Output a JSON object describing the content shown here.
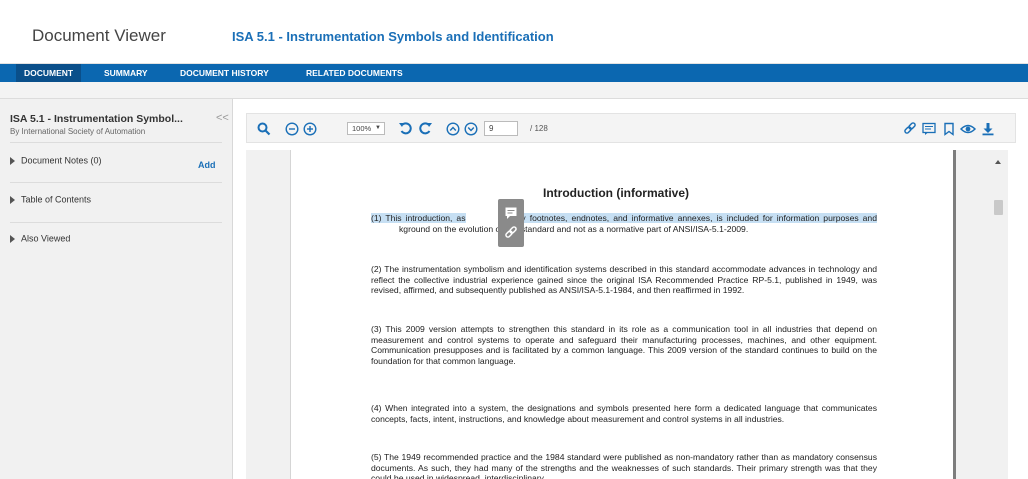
{
  "header": {
    "app_title": "Document Viewer",
    "doc_title": "ISA 5.1 - Instrumentation Symbols and Identification"
  },
  "nav": {
    "tabs": [
      {
        "label": "DOCUMENT",
        "active": true
      },
      {
        "label": "SUMMARY",
        "active": false
      },
      {
        "label": "DOCUMENT HISTORY",
        "active": false
      },
      {
        "label": "RELATED DOCUMENTS",
        "active": false
      }
    ]
  },
  "sidebar": {
    "title": "ISA 5.1 - Instrumentation Symbol...",
    "subtitle": "By International Society of Automation",
    "collapse_label": "<<",
    "items": [
      {
        "label": "Document Notes (0)",
        "action": "Add"
      },
      {
        "label": "Table of Contents"
      },
      {
        "label": "Also Viewed"
      }
    ]
  },
  "toolbar": {
    "zoom_value": "100%",
    "page_number": "9",
    "page_total": "/ 128",
    "icons": [
      "search-icon",
      "zoom-out-icon",
      "zoom-in-icon",
      "rotate-left-icon",
      "rotate-right-icon",
      "page-up-icon",
      "page-down-icon",
      "link-icon",
      "comment-icon",
      "bookmark-icon",
      "view-icon",
      "download-icon"
    ]
  },
  "document": {
    "heading": "Introduction (informative)",
    "p1_highlight_a": "(1) This introduction, as",
    "p1_highlight_b": "s any footnotes, endnotes, and informative annexes, is included for information purposes and",
    "p1_rest": "kground on the evolution of this standard and not as a normative part of ANSI/ISA-5.1-2009.",
    "p2": "(2) The instrumentation symbolism and identification systems described in this standard accommodate advances in technology and reflect the collective industrial experience gained since the original ISA Recommended Practice RP-5.1, published in 1949, was revised, affirmed, and subsequently published as ANSI/ISA-5.1-1984, and then reaffirmed in 1992.",
    "p3": "(3) This 2009 version attempts to strengthen this standard in its role as a communication tool in all industries that depend on measurement and control systems to operate and safeguard their manufacturing processes, machines, and other equipment.  Communication presupposes and is facilitated by a common language.  This 2009 version of the standard continues to build on the foundation for that common language.",
    "p4": "(4) When integrated into a system, the designations and symbols presented here form a dedicated language that communicates concepts, facts, intent, instructions, and knowledge about measurement and control systems in all industries.",
    "p5": "(5) The 1949 recommended practice and the 1984 standard were published as non-mandatory rather than as mandatory consensus documents.  As such, they had many of the strengths and the weaknesses of such standards.  Their primary strength was that they could be used in widespread, interdisciplinary"
  },
  "colors": {
    "brand_blue": "#0b67b0",
    "link_blue": "#1a6fb7",
    "highlight": "#c6dff3"
  }
}
